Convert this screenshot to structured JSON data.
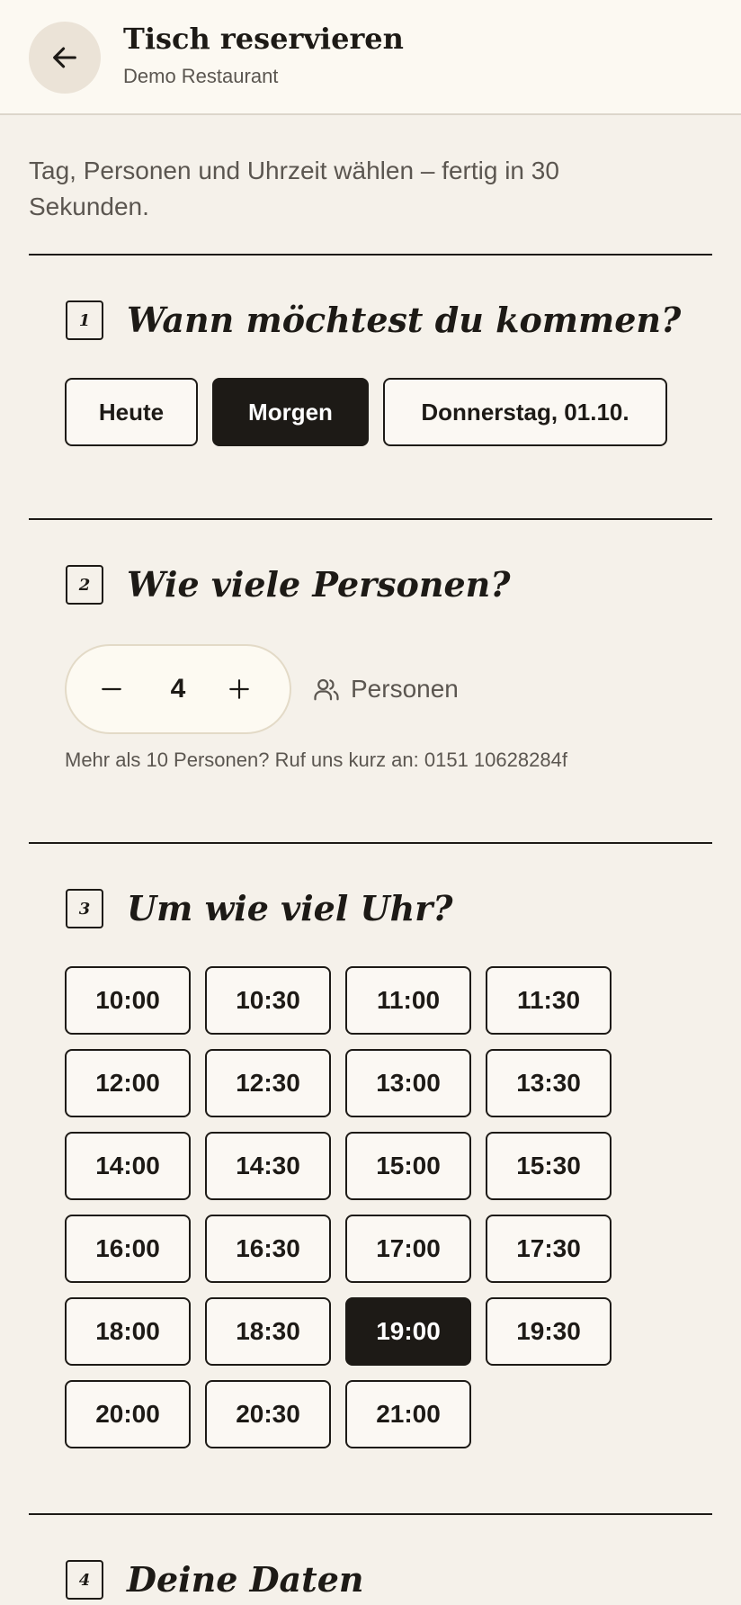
{
  "header": {
    "title": "Tisch reservieren",
    "subtitle": "Demo Restaurant"
  },
  "intro": "Tag, Personen und Uhrzeit wählen – fertig in 30 Sekunden.",
  "step1": {
    "number": "1",
    "title": "Wann möchtest du kommen?",
    "days": [
      {
        "label": "Heute",
        "selected": false
      },
      {
        "label": "Morgen",
        "selected": true
      },
      {
        "label": "Donnerstag, 01.10.",
        "selected": false
      }
    ]
  },
  "step2": {
    "number": "2",
    "title": "Wie viele Personen?",
    "count": "4",
    "minus": "−",
    "plus": "+",
    "unit_label": "Personen",
    "note": "Mehr als 10 Personen? Ruf uns kurz an: 0151 10628284f"
  },
  "step3": {
    "number": "3",
    "title": "Um wie viel Uhr?",
    "selected": "19:00",
    "times": [
      "10:00",
      "10:30",
      "11:00",
      "11:30",
      "12:00",
      "12:30",
      "13:00",
      "13:30",
      "14:00",
      "14:30",
      "15:00",
      "15:30",
      "16:00",
      "16:30",
      "17:00",
      "17:30",
      "18:00",
      "18:30",
      "19:00",
      "19:30",
      "20:00",
      "20:30",
      "21:00"
    ]
  },
  "step4": {
    "number": "4",
    "title": "Deine Daten"
  },
  "colors": {
    "background": "#f5f1ea",
    "header_bg": "#fcf9f2",
    "ink": "#1d1a16",
    "muted": "#5b5650",
    "selected_bg": "#1d1a16",
    "selected_text": "#ffffff"
  },
  "icons": {
    "back": "arrow-left-icon",
    "persons": "users-icon"
  }
}
